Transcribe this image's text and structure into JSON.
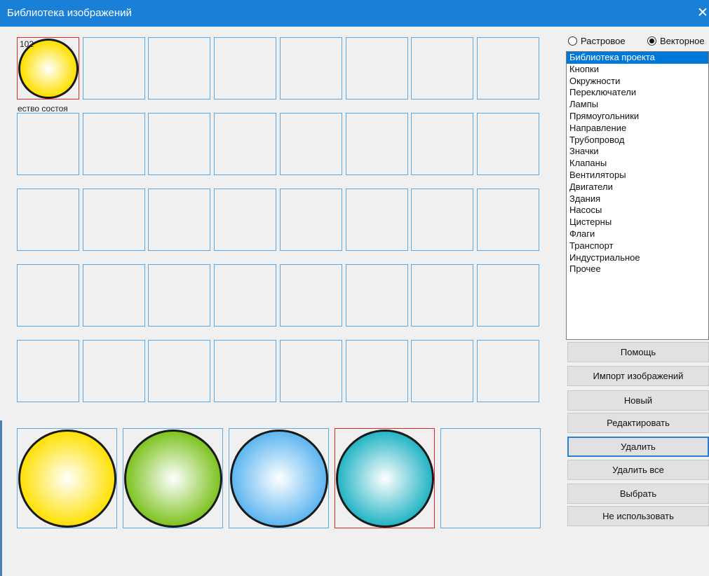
{
  "window": {
    "title": "Библиотека изображений",
    "close_glyph": "✕"
  },
  "grid": {
    "first_cell_number": "102",
    "first_cell_caption": "ество состоя"
  },
  "radio": {
    "raster_label": "Растровое",
    "vector_label": "Векторное",
    "selected": "vector"
  },
  "categories": [
    "Библиотека проекта",
    "Кнопки",
    "Окружности",
    "Переключатели",
    "Лампы",
    "Прямоугольники",
    "Направление",
    "Трубопровод",
    "Значки",
    "Клапаны",
    "Вентиляторы",
    "Двигатели",
    "Здания",
    "Насосы",
    "Цистерны",
    "Флаги",
    "Транспорт",
    "Индустриальное",
    "Прочее"
  ],
  "selected_category": "Библиотека проекта",
  "buttons": {
    "help": "Помощь",
    "import": "Импорт изображений",
    "new": "Новый",
    "edit": "Редактировать",
    "delete": "Удалить",
    "delete_all": "Удалить все",
    "select": "Выбрать",
    "dont_use": "Не использовать"
  },
  "state_images": [
    {
      "name": "yellow",
      "color": "#ffe000"
    },
    {
      "name": "green",
      "color": "#7cc21e"
    },
    {
      "name": "blue",
      "color": "#5bb4f0"
    },
    {
      "name": "teal",
      "color": "#21b3c4"
    }
  ]
}
